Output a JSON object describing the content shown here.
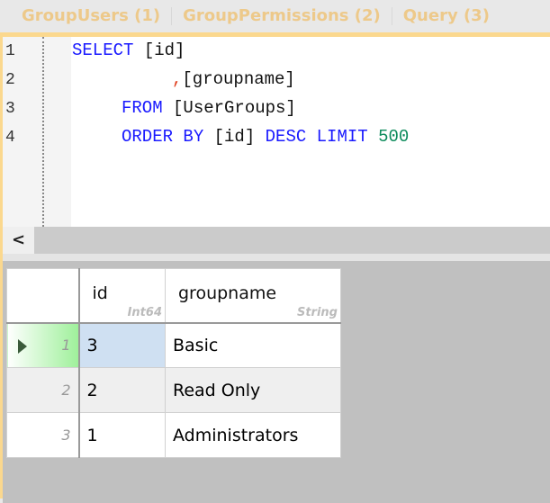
{
  "tabs": [
    "GroupUsers (1)",
    "GroupPermissions (2)",
    "Query (3)"
  ],
  "editor": {
    "line_numbers": [
      "1",
      "2",
      "3",
      "4"
    ],
    "lines": [
      {
        "a": "SELECT ",
        "b": "[id]"
      },
      {
        "comma": ",",
        "b": "[groupname]"
      },
      {
        "a": "FROM ",
        "b": "[UserGroups]"
      },
      {
        "a": "ORDER BY ",
        "b": "[id] ",
        "c": "DESC LIMIT ",
        "d": "500"
      }
    ]
  },
  "scroll_left": "<",
  "grid": {
    "columns": [
      {
        "name": "id",
        "type": "Int64"
      },
      {
        "name": "groupname",
        "type": "String"
      }
    ],
    "rows": [
      {
        "n": "1",
        "id": "3",
        "groupname": "Basic"
      },
      {
        "n": "2",
        "id": "2",
        "groupname": "Read Only"
      },
      {
        "n": "3",
        "id": "1",
        "groupname": "Administrators"
      }
    ]
  }
}
